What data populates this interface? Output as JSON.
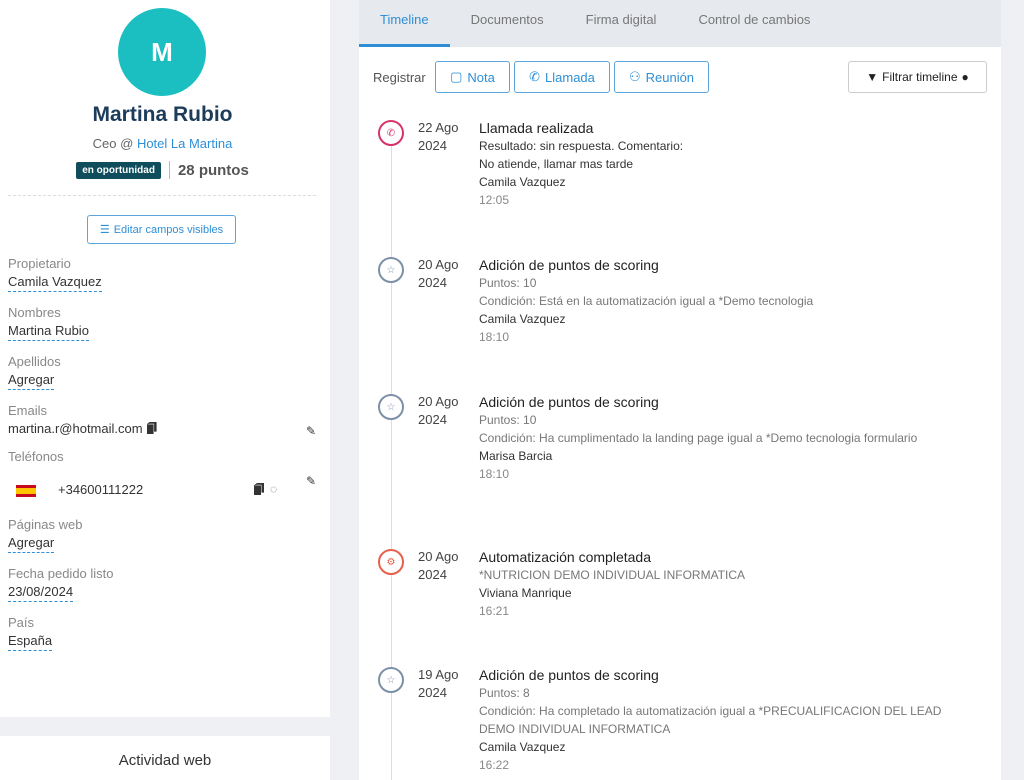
{
  "contact": {
    "initial": "M",
    "name": "Martina Rubio",
    "role_prefix": "Ceo @ ",
    "company": "Hotel La Martina",
    "badge": "en oportunidad",
    "points": "28 puntos",
    "edit_label": "Editar campos visibles"
  },
  "fields": {
    "propietario_label": "Propietario",
    "propietario": "Camila Vazquez",
    "nombres_label": "Nombres",
    "nombres": "Martina Rubio",
    "apellidos_label": "Apellidos",
    "apellidos": "Agregar",
    "emails_label": "Emails",
    "email": "martina.r@hotmail.com",
    "telefonos_label": "Teléfonos",
    "phone": "+34600111222",
    "paginas_label": "Páginas web",
    "paginas": "Agregar",
    "fecha_label": "Fecha pedido listo",
    "fecha": "23/08/2024",
    "pais_label": "País",
    "pais": "España"
  },
  "web_activity": "Actividad web",
  "tabs": [
    "Timeline",
    "Documentos",
    "Firma digital",
    "Control de cambios"
  ],
  "toolbar": {
    "registrar": "Registrar",
    "nota": "Nota",
    "llamada": "Llamada",
    "reunion": "Reunión",
    "filter": "Filtrar timeline"
  },
  "timeline": [
    {
      "type": "call",
      "date1": "22 Ago",
      "date2": "2024",
      "title": "Llamada realizada",
      "lines": [
        "Resultado: sin respuesta.   Comentario:",
        "No atiende, llamar mas tarde"
      ],
      "user": "Camila Vazquez",
      "time": "12:05"
    },
    {
      "type": "score",
      "date1": "20 Ago",
      "date2": "2024",
      "title": "Adición de puntos de scoring",
      "points": "Puntos: 10",
      "condition": "Condición: Está en la automatización igual a *Demo tecnologia",
      "user": "Camila Vazquez",
      "time": "18:10"
    },
    {
      "type": "score",
      "date1": "20 Ago",
      "date2": "2024",
      "title": "Adición de puntos de scoring",
      "points": "Puntos: 10",
      "condition": "Condición: Ha cumplimentado la landing page igual a *Demo tecnologia formulario",
      "user": "Marisa Barcia",
      "time": "18:10"
    },
    {
      "type": "auto",
      "date1": "20 Ago",
      "date2": "2024",
      "title": "Automatización completada",
      "detail": "*NUTRICION DEMO INDIVIDUAL INFORMATICA",
      "user": "Viviana Manrique",
      "time": "16:21"
    },
    {
      "type": "score",
      "date1": "19 Ago",
      "date2": "2024",
      "title": "Adición de puntos de scoring",
      "points": "Puntos: 8",
      "condition": "Condición: Ha completado la automatización igual a *PRECUALIFICACION DEL LEAD DEMO INDIVIDUAL INFORMATICA",
      "user": "Camila Vazquez",
      "time": "16:22"
    }
  ]
}
